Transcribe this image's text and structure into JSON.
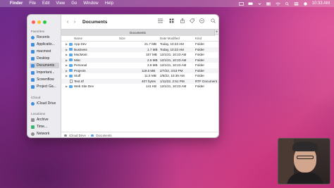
{
  "menubar": {
    "apple_glyph": "",
    "items": [
      "Finder",
      "File",
      "Edit",
      "View",
      "Go",
      "Window",
      "Help"
    ],
    "clock": "10:33 AM"
  },
  "window": {
    "title": "Documents",
    "tab_label": "Documents",
    "nav_back": "‹",
    "nav_forward": "›",
    "tab_add": "+"
  },
  "sidebar": {
    "favorites_title": "Favorites",
    "favorites": [
      {
        "label": "Recents",
        "icon": "clock-icon"
      },
      {
        "label": "Applicatio...",
        "icon": "apps-icon"
      },
      {
        "label": "macmost",
        "icon": "home-icon"
      },
      {
        "label": "Desktop",
        "icon": "desktop-icon"
      },
      {
        "label": "Documents",
        "icon": "document-icon",
        "selected": true
      },
      {
        "label": "Important...",
        "icon": "folder-icon"
      },
      {
        "label": "Screenflow",
        "icon": "folder-icon"
      },
      {
        "label": "Project Ga...",
        "icon": "folder-icon"
      }
    ],
    "icloud_title": "iCloud",
    "icloud": [
      {
        "label": "iCloud Drive",
        "icon": "cloud-icon"
      }
    ],
    "locations_title": "Locations",
    "locations": [
      {
        "label": "Archive",
        "icon": "drive-icon"
      },
      {
        "label": "Time...",
        "icon": "time-machine-icon"
      },
      {
        "label": "Network",
        "icon": "network-icon"
      }
    ]
  },
  "columns": {
    "name": "Name",
    "size": "Size",
    "date": "Date Modified",
    "kind": "Kind"
  },
  "files": [
    {
      "name": "App Dev",
      "size": "21.7 MB",
      "date": "Today, 10:23 AM",
      "kind": "Folder",
      "type": "folder"
    },
    {
      "name": "Business",
      "size": "1.7 MB",
      "date": "Today, 10:23 AM",
      "kind": "Folder",
      "type": "folder"
    },
    {
      "name": "MacMost",
      "size": "157 MB",
      "date": "12/1/21, 10:23 AM",
      "kind": "Folder",
      "type": "folder"
    },
    {
      "name": "Misc",
      "size": "2.5 MB",
      "date": "12/1/21, 10:23 AM",
      "kind": "Folder",
      "type": "folder"
    },
    {
      "name": "Personal",
      "size": "3.8 MB",
      "date": "12/1/21, 10:23 AM",
      "kind": "Folder",
      "type": "folder"
    },
    {
      "name": "Projects",
      "size": "119.6 MB",
      "date": "2/7/22, 3:53 PM",
      "kind": "Folder",
      "type": "folder"
    },
    {
      "name": "Stuff",
      "size": "11.5 MB",
      "date": "2/8/22, 10:39 AM",
      "kind": "Folder",
      "type": "folder"
    },
    {
      "name": "Text.rtf",
      "size": "407 bytes",
      "date": "1/11/22, 2:51 PM",
      "kind": "RTF Document",
      "type": "document"
    },
    {
      "name": "Web Site Dev",
      "size": "141 KB",
      "date": "12/1/21, 10:23 AM",
      "kind": "Folder",
      "type": "folder"
    }
  ],
  "pathbar": [
    "iCloud Drive",
    "Documents"
  ],
  "colors": {
    "accent": "#3e8de0",
    "folder": "#5aa7ea"
  }
}
